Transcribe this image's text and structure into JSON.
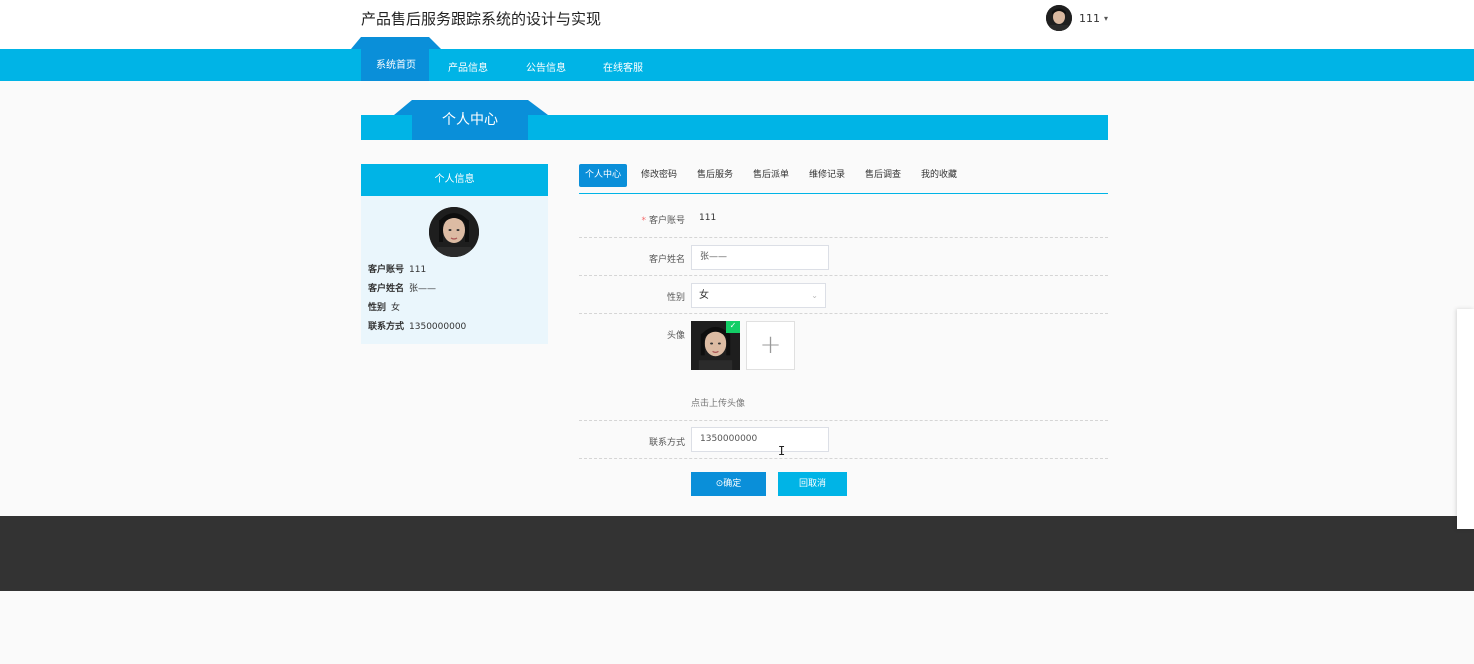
{
  "header": {
    "site_title": "产品售后服务跟踪系统的设计与实现",
    "user_name": "111",
    "caret": "▾"
  },
  "nav": {
    "items": [
      "系统首页",
      "产品信息",
      "公告信息",
      "在线客服"
    ],
    "active_index": 0
  },
  "section": {
    "title": "个人中心"
  },
  "side_panel": {
    "title": "个人信息",
    "fields": [
      {
        "label": "客户账号",
        "value": "111"
      },
      {
        "label": "客户姓名",
        "value": "张——"
      },
      {
        "label": "性别",
        "value": "女"
      },
      {
        "label": "联系方式",
        "value": "1350000000"
      }
    ]
  },
  "tabs": {
    "items": [
      "个人中心",
      "修改密码",
      "售后服务",
      "售后派单",
      "维修记录",
      "售后调查",
      "我的收藏"
    ],
    "active_index": 0
  },
  "form": {
    "account": {
      "label": "客户账号",
      "required_mark": "*",
      "value": "111"
    },
    "name": {
      "label": "客户姓名",
      "value": "张——"
    },
    "gender": {
      "label": "性别",
      "value": "女",
      "arrow": "⌄"
    },
    "avatar": {
      "label": "头像",
      "hint": "点击上传头像",
      "add_glyph": "+",
      "check_glyph": "✓"
    },
    "phone": {
      "label": "联系方式",
      "value": "1350000000"
    }
  },
  "buttons": {
    "confirm": "⊙确定",
    "cancel": "回取消"
  },
  "cursor_glyph": "I",
  "colors": {
    "primary": "#00b4e6",
    "primary_dark": "#0a8fd9",
    "footer": "#333333",
    "success": "#13ce66",
    "required": "#f56c6c"
  }
}
